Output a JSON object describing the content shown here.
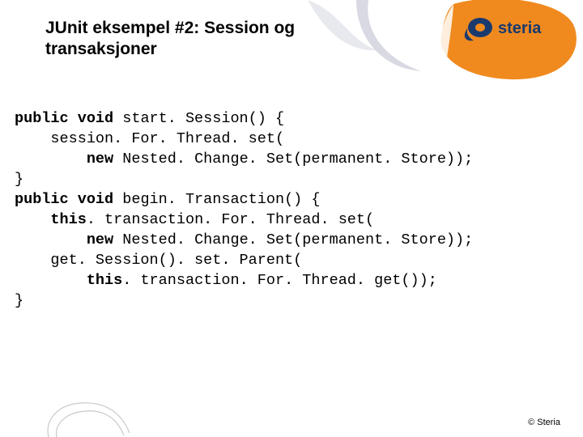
{
  "slide": {
    "title": "JUnit eksempel #2: Session og transaksjoner",
    "logo_text": "steria",
    "footer": "© Steria"
  },
  "code": {
    "lines": [
      {
        "indent": 0,
        "segments": [
          {
            "kw": true,
            "t": "public void "
          },
          {
            "kw": false,
            "t": "start. Session() {"
          }
        ]
      },
      {
        "indent": 1,
        "segments": [
          {
            "kw": false,
            "t": "session. For. Thread. set("
          }
        ]
      },
      {
        "indent": 2,
        "segments": [
          {
            "kw": true,
            "t": "new "
          },
          {
            "kw": false,
            "t": "Nested. Change. Set(permanent. Store));"
          }
        ]
      },
      {
        "indent": 0,
        "segments": [
          {
            "kw": false,
            "t": "}"
          }
        ]
      },
      {
        "indent": 0,
        "segments": [
          {
            "kw": false,
            "t": ""
          }
        ]
      },
      {
        "indent": 0,
        "segments": [
          {
            "kw": true,
            "t": "public void "
          },
          {
            "kw": false,
            "t": "begin. Transaction() {"
          }
        ]
      },
      {
        "indent": 1,
        "segments": [
          {
            "kw": true,
            "t": "this"
          },
          {
            "kw": false,
            "t": ". transaction. For. Thread. set("
          }
        ]
      },
      {
        "indent": 2,
        "segments": [
          {
            "kw": true,
            "t": "new "
          },
          {
            "kw": false,
            "t": "Nested. Change. Set(permanent. Store));"
          }
        ]
      },
      {
        "indent": 1,
        "segments": [
          {
            "kw": false,
            "t": "get. Session(). set. Parent("
          }
        ]
      },
      {
        "indent": 2,
        "segments": [
          {
            "kw": true,
            "t": "this"
          },
          {
            "kw": false,
            "t": ". transaction. For. Thread. get());"
          }
        ]
      },
      {
        "indent": 0,
        "segments": [
          {
            "kw": false,
            "t": "}"
          }
        ]
      }
    ]
  }
}
